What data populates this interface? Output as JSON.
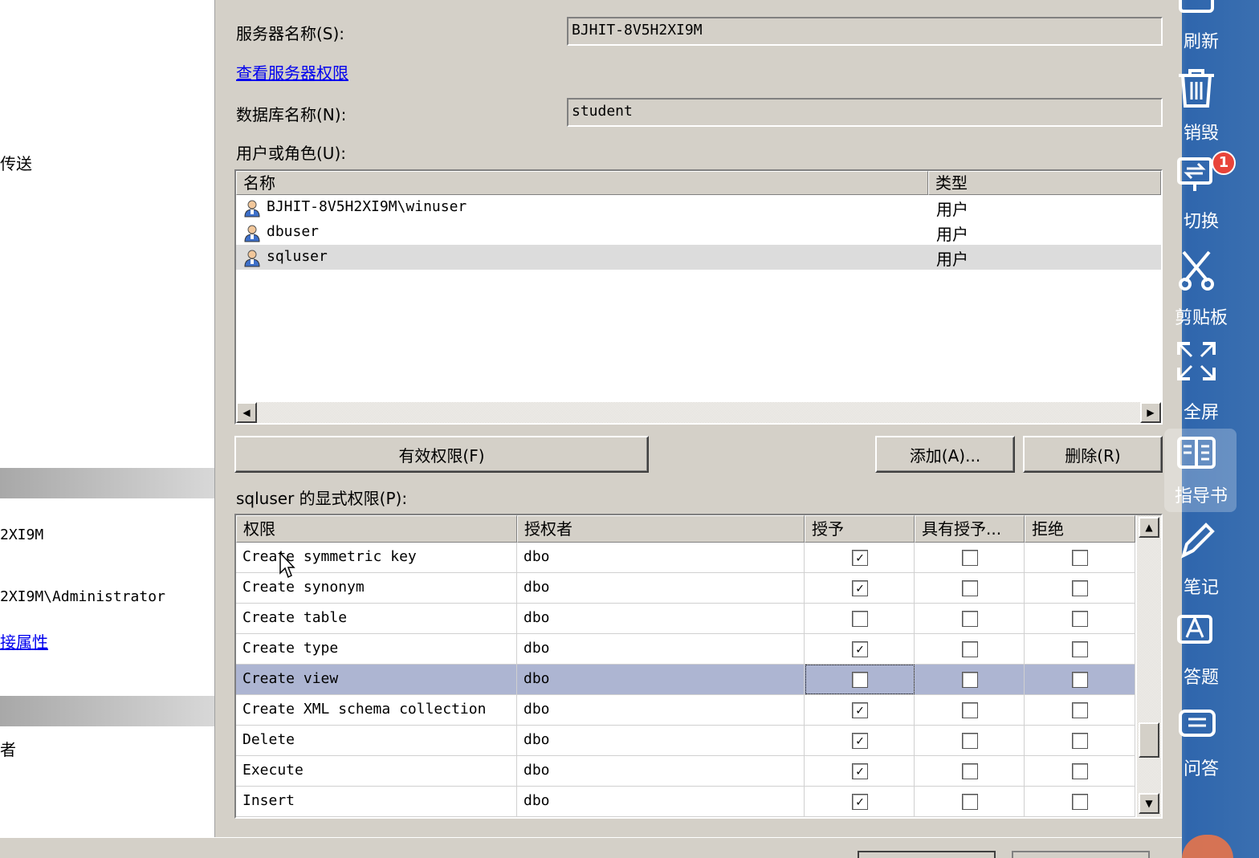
{
  "left_pane": {
    "text1": "传送",
    "text2": "2XI9M",
    "text3": "2XI9M\\Administrator",
    "link": "接属性",
    "text4": "者"
  },
  "form": {
    "server_name_label": "服务器名称(S):",
    "server_name_value": "BJHIT-8V5H2XI9M",
    "view_server_permissions_link": "查看服务器权限",
    "database_name_label": "数据库名称(N):",
    "database_name_value": "student",
    "users_roles_label": "用户或角色(U):",
    "effective_permissions_button": "有效权限(F)",
    "add_button": "添加(A)...",
    "remove_button": "删除(R)",
    "explicit_permissions_label": "sqluser 的显式权限(P):"
  },
  "user_list": {
    "columns": [
      "名称",
      "类型"
    ],
    "rows": [
      {
        "name": "BJHIT-8V5H2XI9M\\winuser",
        "type": "用户",
        "selected": false
      },
      {
        "name": "dbuser",
        "type": "用户",
        "selected": false
      },
      {
        "name": "sqluser",
        "type": "用户",
        "selected": true
      }
    ]
  },
  "perm_grid": {
    "columns": [
      "权限",
      "授权者",
      "授予",
      "具有授予...",
      "拒绝"
    ],
    "rows": [
      {
        "permission": "Create symmetric key",
        "grantor": "dbo",
        "grant": true,
        "with_grant": false,
        "deny": false
      },
      {
        "permission": "Create synonym",
        "grantor": "dbo",
        "grant": true,
        "with_grant": false,
        "deny": false
      },
      {
        "permission": "Create table",
        "grantor": "dbo",
        "grant": false,
        "with_grant": false,
        "deny": false
      },
      {
        "permission": "Create type",
        "grantor": "dbo",
        "grant": true,
        "with_grant": false,
        "deny": false
      },
      {
        "permission": "Create view",
        "grantor": "dbo",
        "grant": false,
        "with_grant": false,
        "deny": false,
        "selected": true
      },
      {
        "permission": "Create XML schema collection",
        "grantor": "dbo",
        "grant": true,
        "with_grant": false,
        "deny": false
      },
      {
        "permission": "Delete",
        "grantor": "dbo",
        "grant": true,
        "with_grant": false,
        "deny": false
      },
      {
        "permission": "Execute",
        "grantor": "dbo",
        "grant": true,
        "with_grant": false,
        "deny": false
      },
      {
        "permission": "Insert",
        "grantor": "dbo",
        "grant": true,
        "with_grant": false,
        "deny": false
      }
    ]
  },
  "side_toolbar": {
    "items": [
      {
        "label": "刷新",
        "icon": "refresh-icon"
      },
      {
        "label": "销毁",
        "icon": "trash-icon"
      },
      {
        "label": "切换",
        "icon": "switch-icon",
        "badge": "1"
      },
      {
        "label": "剪贴板",
        "icon": "scissors-icon"
      },
      {
        "label": "全屏",
        "icon": "fullscreen-icon"
      },
      {
        "label": "指导书",
        "icon": "book-icon",
        "active": true
      },
      {
        "label": "笔记",
        "icon": "pencil-icon"
      },
      {
        "label": "答题",
        "icon": "answer-icon"
      },
      {
        "label": "问答",
        "icon": "chat-icon"
      }
    ]
  },
  "colors": {
    "window_bg": "#d4d0c8",
    "selected_row": "#adb5d2",
    "toolbar_bg": "#3a6fb0",
    "badge": "#e8443a"
  }
}
